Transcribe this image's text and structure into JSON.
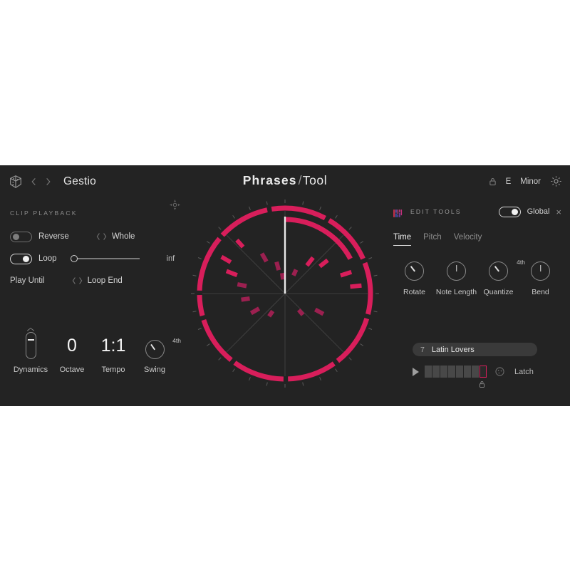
{
  "header": {
    "dice_icon": "dice-icon",
    "prev_icon": "chevron-left-icon",
    "next_icon": "chevron-right-icon",
    "preset_name": "Gestio",
    "title_bold": "Phrases",
    "title_slash": "/",
    "title_light": "Tool",
    "lock_icon": "lock-icon",
    "key_root": "E",
    "key_scale": "Minor",
    "gear_icon": "gear-icon"
  },
  "clip_playback": {
    "section_label": "CLIP PLAYBACK",
    "reverse_label": "Reverse",
    "reverse_on": false,
    "loop_label": "Loop",
    "loop_on": true,
    "whole_label": "Whole",
    "slider_value": "inf",
    "play_until_label": "Play Until",
    "loop_end_label": "Loop End"
  },
  "params": [
    {
      "name": "Dynamics",
      "type": "vslider",
      "sup": ""
    },
    {
      "name": "Octave",
      "type": "value",
      "value": "0",
      "sup": ""
    },
    {
      "name": "Tempo",
      "type": "value",
      "value": "1:1",
      "sup": ""
    },
    {
      "name": "Swing",
      "type": "knob",
      "sup": "4th"
    }
  ],
  "edit_tools": {
    "icon": "edit-tools-bars-icon",
    "title": "EDIT TOOLS",
    "global_label": "Global",
    "global_on": true,
    "close_label": "×",
    "tabs": [
      {
        "label": "Time",
        "active": true
      },
      {
        "label": "Pitch",
        "active": false
      },
      {
        "label": "Velocity",
        "active": false
      }
    ],
    "knobs": [
      {
        "name": "Rotate",
        "sup": ""
      },
      {
        "name": "Note Length",
        "sup": ""
      },
      {
        "name": "Quantize",
        "sup": "4th"
      },
      {
        "name": "Bend",
        "sup": ""
      }
    ]
  },
  "pattern": {
    "index": "7",
    "name": "Latin Lovers",
    "play_icon": "play-icon",
    "slot_count": 8,
    "selected_slot": 8,
    "lock_icon": "lock-open-icon",
    "dice_icon": "dice-randomize-icon",
    "latch_label": "Latch"
  },
  "viz": {
    "crosshair_icon": "crosshair-move-icon",
    "accent_color": "#d81e5b",
    "playhead_color": "#e8e8e8",
    "note_color_dim": "#9c2050"
  },
  "chart_data": {
    "type": "radial",
    "title": "Phrase circle visualizer",
    "ring_segments": [
      {
        "start": 272,
        "end": 310
      },
      {
        "start": 313,
        "end": 348
      },
      {
        "start": 351,
        "end": 28
      },
      {
        "start": 31,
        "end": 66
      },
      {
        "start": 69,
        "end": 104
      },
      {
        "start": 107,
        "end": 142
      },
      {
        "start": 145,
        "end": 178
      },
      {
        "start": 181,
        "end": 216
      },
      {
        "start": 219,
        "end": 252
      },
      {
        "start": 255,
        "end": 269
      }
    ],
    "progress_arc": {
      "start": 0,
      "end": 62,
      "radius": 104
    },
    "playhead_angle": 0,
    "divider_count": 8,
    "notes": [
      {
        "angle": 318,
        "radius": 88,
        "len": 13,
        "dim": false
      },
      {
        "angle": 300,
        "radius": 88,
        "len": 15,
        "dim": false
      },
      {
        "angle": 291,
        "radius": 72,
        "len": 16,
        "dim": false
      },
      {
        "angle": 281,
        "radius": 55,
        "len": 13,
        "dim": true
      },
      {
        "angle": 330,
        "radius": 52,
        "len": 13,
        "dim": true
      },
      {
        "angle": 345,
        "radius": 34,
        "len": 12,
        "dim": true
      },
      {
        "angle": 352,
        "radius": 20,
        "len": 9,
        "dim": true
      },
      {
        "angle": 25,
        "radius": 28,
        "len": 9,
        "dim": true
      },
      {
        "angle": 38,
        "radius": 50,
        "len": 14,
        "dim": false
      },
      {
        "angle": 52,
        "radius": 62,
        "len": 14,
        "dim": false
      },
      {
        "angle": 72,
        "radius": 82,
        "len": 16,
        "dim": false
      },
      {
        "angle": 84,
        "radius": 92,
        "len": 16,
        "dim": false
      },
      {
        "angle": 118,
        "radius": 48,
        "len": 13,
        "dim": true
      },
      {
        "angle": 140,
        "radius": 30,
        "len": 9,
        "dim": true
      },
      {
        "angle": 215,
        "radius": 30,
        "len": 9,
        "dim": true
      },
      {
        "angle": 240,
        "radius": 42,
        "len": 13,
        "dim": true
      },
      {
        "angle": 262,
        "radius": 50,
        "len": 12,
        "dim": true
      }
    ]
  }
}
